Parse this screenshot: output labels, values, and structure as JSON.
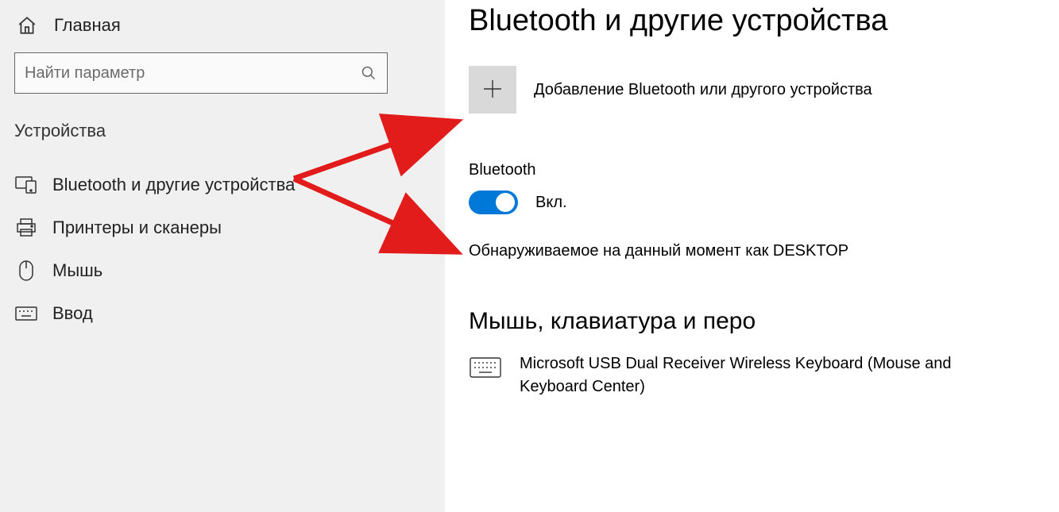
{
  "sidebar": {
    "home_label": "Главная",
    "search_placeholder": "Найти параметр",
    "section_title": "Устройства",
    "items": [
      {
        "label": "Bluetooth и другие устройства"
      },
      {
        "label": "Принтеры и сканеры"
      },
      {
        "label": "Мышь"
      },
      {
        "label": "Ввод"
      }
    ]
  },
  "main": {
    "title": "Bluetooth и другие устройства",
    "add_device_label": "Добавление Bluetooth или другого устройства",
    "bluetooth_label": "Bluetooth",
    "toggle_state_label": "Вкл.",
    "discoverable_text": "Обнаруживаемое на данный момент как   DESKTOP",
    "sub_heading": "Мышь, клавиатура и перо",
    "device_name": "Microsoft USB Dual Receiver Wireless Keyboard (Mouse and Keyboard Center)"
  }
}
